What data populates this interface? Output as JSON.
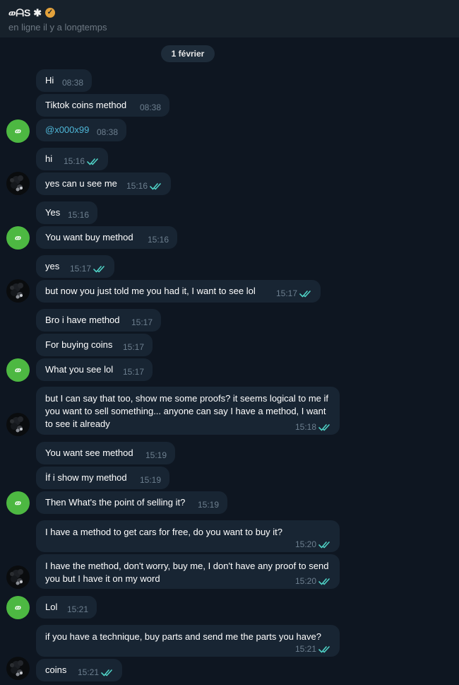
{
  "header": {
    "name": "ወᗩЅ ✱",
    "verified_icon": "verified-check-icon",
    "status": "en ligne il y a longtemps"
  },
  "date_separator": "1 février",
  "avatars": {
    "green_letter": "ወ",
    "green_color": "#4db842",
    "dark_icon": "user-photo-avatar"
  },
  "messages": [
    {
      "text": "Hi",
      "time": "08:38"
    },
    {
      "text": "Tiktok coins method",
      "time": "08:38"
    },
    {
      "text": "@x000x99",
      "time": "08:38"
    },
    {
      "text": "hi",
      "time": "15:16"
    },
    {
      "text": "yes can u see me",
      "time": "15:16"
    },
    {
      "text": "Yes",
      "time": "15:16"
    },
    {
      "text": "You want buy method",
      "time": "15:16"
    },
    {
      "text": "yes",
      "time": "15:17"
    },
    {
      "text": "but now you just told me you had it, I want to see lol",
      "time": "15:17"
    },
    {
      "text": "Bro i have method",
      "time": "15:17"
    },
    {
      "text": "For buying coins",
      "time": "15:17"
    },
    {
      "text": "What you see lol",
      "time": "15:17"
    },
    {
      "text": "but I can say that too, show me some proofs? it seems logical to me if you want to sell something... anyone can say I have a method, I want to see it already",
      "time": "15:18"
    },
    {
      "text": "You want see method",
      "time": "15:19"
    },
    {
      "text": "İf i show my method",
      "time": "15:19"
    },
    {
      "text": "Then What's the point of selling it?",
      "time": "15:19"
    },
    {
      "text": "I have a method to get cars for free, do you want to buy it?",
      "time": "15:20"
    },
    {
      "text": "I have the method, don't worry, buy me, I don't have any proof to send you but I have it on my word",
      "time": "15:20"
    },
    {
      "text": "Lol",
      "time": "15:21"
    },
    {
      "text": "if you have a technique, buy parts and send me the parts you have?",
      "time": "15:21"
    },
    {
      "text": "coins",
      "time": "15:21"
    }
  ],
  "colors": {
    "background": "#0e1621",
    "header": "#17212b",
    "bubble": "#182533",
    "read_check": "#4fd1c5",
    "mention": "#4fb7d8"
  }
}
